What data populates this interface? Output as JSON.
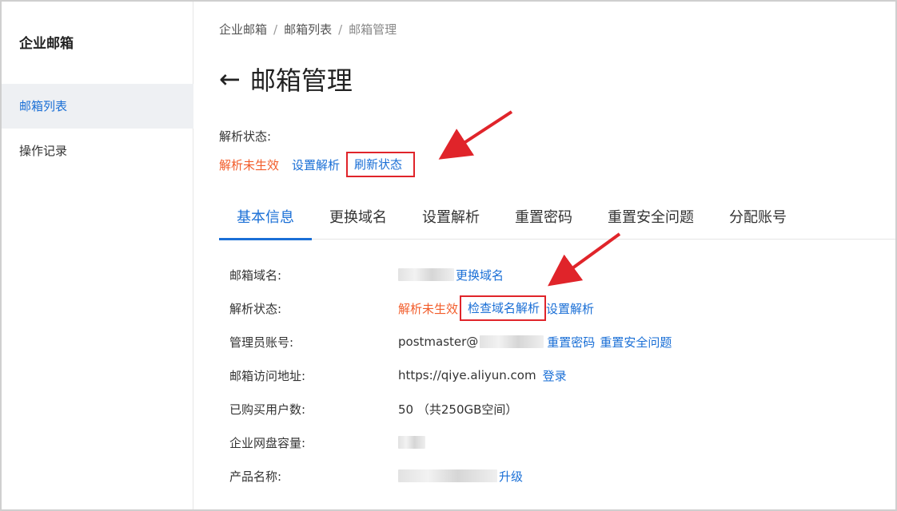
{
  "sidebar": {
    "title": "企业邮箱",
    "items": [
      {
        "label": "邮箱列表"
      },
      {
        "label": "操作记录"
      }
    ]
  },
  "breadcrumb": {
    "items": [
      "企业邮箱",
      "邮箱列表",
      "邮箱管理"
    ],
    "sep": "/"
  },
  "header": {
    "back_icon": "←",
    "title": "邮箱管理"
  },
  "resolve_status": {
    "label": "解析状态:",
    "state": "解析未生效",
    "set_link": "设置解析",
    "refresh_link": "刷新状态"
  },
  "tabs": [
    "基本信息",
    "更换域名",
    "设置解析",
    "重置密码",
    "重置安全问题",
    "分配账号"
  ],
  "info": {
    "domain": {
      "label": "邮箱域名:",
      "link": "更换域名"
    },
    "resolve": {
      "label": "解析状态:",
      "state": "解析未生效",
      "check_link": "检查域名解析",
      "set_link": "设置解析"
    },
    "admin": {
      "label": "管理员账号:",
      "value": "postmaster@",
      "reset_pwd": "重置密码",
      "reset_security": "重置安全问题"
    },
    "access": {
      "label": "邮箱访问地址:",
      "value": "https://qiye.aliyun.com",
      "login": "登录"
    },
    "users": {
      "label": "已购买用户数:",
      "value": "50 （共250GB空间）"
    },
    "disk": {
      "label": "企业网盘容量:"
    },
    "product": {
      "label": "产品名称:",
      "upgrade": "升级"
    }
  },
  "colors": {
    "accent": "#1a6fd6",
    "error": "#f25c2a",
    "annotation": "#e0242a"
  }
}
